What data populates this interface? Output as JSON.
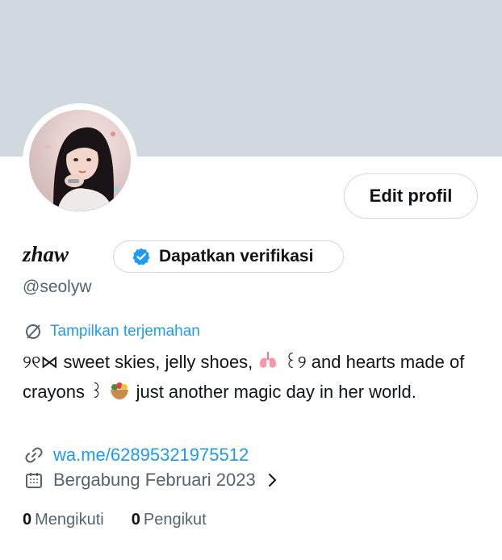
{
  "profile": {
    "display_name": "zhaw",
    "handle": "@seolyw",
    "edit_label": "Edit profil",
    "verify_label": "Dapatkan verifikasi",
    "translate_label": "Tampilkan terjemahan",
    "bio": {
      "part1": "୨୧⋈ sweet skies, jelly shoes, ",
      "part2": " ꒰୨ and hearts made of crayons ꒱ ",
      "part3": " just another magic day in her world."
    },
    "link": "wa.me/62895321975512",
    "joined": "Bergabung Februari 2023",
    "following_count": "0",
    "following_label": "Mengikuti",
    "followers_count": "0",
    "followers_label": "Pengikut"
  },
  "colors": {
    "banner": "#cfd9de",
    "accent": "#1d9bf0",
    "muted": "#536471",
    "text": "#0f1419"
  },
  "icons": [
    "verified-badge-icon",
    "translate-icon",
    "link-icon",
    "calendar-icon",
    "chevron-right-icon"
  ]
}
